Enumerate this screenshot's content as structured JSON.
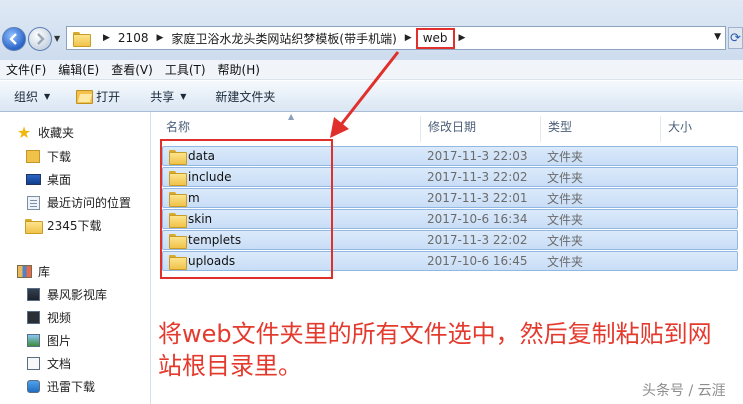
{
  "addressbar": {
    "crumbs": [
      "2108",
      "家庭卫浴水龙头类网站织梦模板(带手机端)",
      "web"
    ]
  },
  "menubar": [
    {
      "label": "文件(F)"
    },
    {
      "label": "编辑(E)"
    },
    {
      "label": "查看(V)"
    },
    {
      "label": "工具(T)"
    },
    {
      "label": "帮助(H)"
    }
  ],
  "toolbar": {
    "organize": "组织",
    "open": "打开",
    "share": "共享",
    "new_folder": "新建文件夹"
  },
  "navpane": {
    "favorites_title": "收藏夹",
    "favorites": [
      {
        "label": "下载",
        "icon": "download-folder-icon"
      },
      {
        "label": "桌面",
        "icon": "desktop-icon"
      },
      {
        "label": "最近访问的位置",
        "icon": "recent-places-icon"
      },
      {
        "label": "2345下载",
        "icon": "folder-icon"
      }
    ],
    "libraries_title": "库",
    "libraries": [
      {
        "label": "暴风影视库",
        "icon": "video-library-icon"
      },
      {
        "label": "视频",
        "icon": "videos-icon"
      },
      {
        "label": "图片",
        "icon": "pictures-icon"
      },
      {
        "label": "文档",
        "icon": "documents-icon"
      },
      {
        "label": "迅雷下载",
        "icon": "thunder-download-icon"
      }
    ]
  },
  "filelist": {
    "columns": {
      "name": "名称",
      "modified": "修改日期",
      "type": "类型",
      "size": "大小"
    },
    "rows": [
      {
        "name": "data",
        "modified": "2017-11-3 22:03",
        "type": "文件夹"
      },
      {
        "name": "include",
        "modified": "2017-11-3 22:02",
        "type": "文件夹"
      },
      {
        "name": "m",
        "modified": "2017-11-3 22:01",
        "type": "文件夹"
      },
      {
        "name": "skin",
        "modified": "2017-10-6 16:34",
        "type": "文件夹"
      },
      {
        "name": "templets",
        "modified": "2017-11-3 22:02",
        "type": "文件夹"
      },
      {
        "name": "uploads",
        "modified": "2017-10-6 16:45",
        "type": "文件夹"
      }
    ]
  },
  "annotation": {
    "text": "将web文件夹里的所有文件选中，然后复制粘贴到网站根目录里。",
    "color": "#e43a2e"
  },
  "watermark": "头条号 / 云涯"
}
